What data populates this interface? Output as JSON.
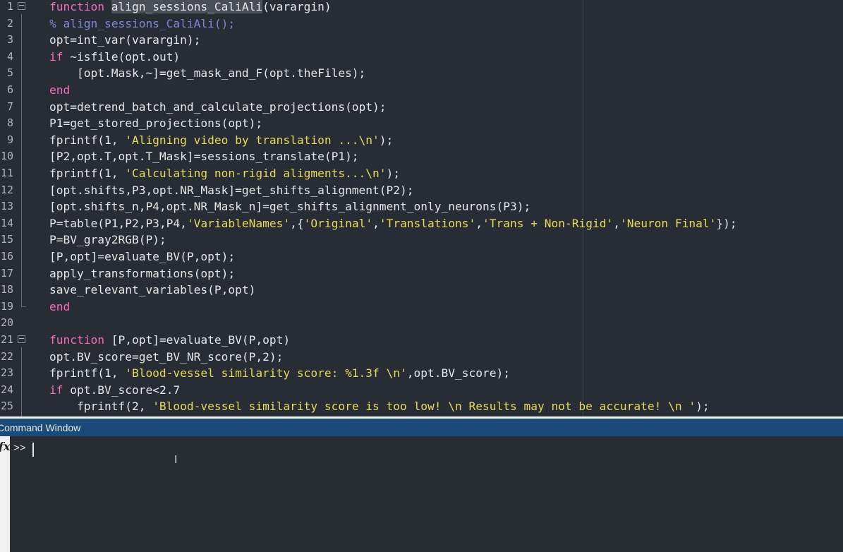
{
  "editor": {
    "lines": [
      {
        "num": "1",
        "parts": [
          {
            "t": "kw",
            "v": "function "
          },
          {
            "t": "hl",
            "v": "align_sessions_CaliAli"
          },
          {
            "t": "p",
            "v": "(varargin)"
          }
        ]
      },
      {
        "num": "2",
        "parts": [
          {
            "t": "cmt",
            "v": "% align_sessions_CaliAli();"
          }
        ]
      },
      {
        "num": "3",
        "parts": [
          {
            "t": "p",
            "v": "opt=int_var(varargin);"
          }
        ]
      },
      {
        "num": "4",
        "parts": [
          {
            "t": "kw",
            "v": "if "
          },
          {
            "t": "p",
            "v": "~isfile(opt.out)"
          }
        ]
      },
      {
        "num": "5",
        "parts": [
          {
            "t": "p",
            "v": "    [opt.Mask,~]=get_mask_and_F(opt.theFiles);"
          }
        ]
      },
      {
        "num": "6",
        "parts": [
          {
            "t": "kw",
            "v": "end"
          }
        ]
      },
      {
        "num": "7",
        "parts": [
          {
            "t": "p",
            "v": "opt=detrend_batch_and_calculate_projections(opt);"
          }
        ]
      },
      {
        "num": "8",
        "parts": [
          {
            "t": "p",
            "v": "P1=get_stored_projections(opt);"
          }
        ]
      },
      {
        "num": "9",
        "parts": [
          {
            "t": "p",
            "v": "fprintf(1, "
          },
          {
            "t": "str",
            "v": "'Aligning video by translation ...\\n'"
          },
          {
            "t": "p",
            "v": ");"
          }
        ]
      },
      {
        "num": "10",
        "parts": [
          {
            "t": "p",
            "v": "[P2,opt.T,opt.T_Mask]=sessions_translate(P1);"
          }
        ]
      },
      {
        "num": "11",
        "parts": [
          {
            "t": "p",
            "v": "fprintf(1, "
          },
          {
            "t": "str",
            "v": "'Calculating non-rigid aligments...\\n'"
          },
          {
            "t": "p",
            "v": ");"
          }
        ]
      },
      {
        "num": "12",
        "parts": [
          {
            "t": "p",
            "v": "[opt.shifts,P3,opt.NR_Mask]=get_shifts_alignment(P2);"
          }
        ]
      },
      {
        "num": "13",
        "parts": [
          {
            "t": "p",
            "v": "[opt.shifts_n,P4,opt.NR_Mask_n]=get_shifts_alignment_only_neurons(P3);"
          }
        ]
      },
      {
        "num": "14",
        "parts": [
          {
            "t": "p",
            "v": "P=table(P1,P2,P3,P4,"
          },
          {
            "t": "str",
            "v": "'VariableNames'"
          },
          {
            "t": "p",
            "v": ",{"
          },
          {
            "t": "str",
            "v": "'Original'"
          },
          {
            "t": "p",
            "v": ","
          },
          {
            "t": "str",
            "v": "'Translations'"
          },
          {
            "t": "p",
            "v": ","
          },
          {
            "t": "str",
            "v": "'Trans + Non-Rigid'"
          },
          {
            "t": "p",
            "v": ","
          },
          {
            "t": "str",
            "v": "'Neuron Final'"
          },
          {
            "t": "p",
            "v": "});"
          }
        ]
      },
      {
        "num": "15",
        "parts": [
          {
            "t": "p",
            "v": "P=BV_gray2RGB(P);"
          }
        ]
      },
      {
        "num": "16",
        "parts": [
          {
            "t": "p",
            "v": "[P,opt]=evaluate_BV(P,opt);"
          }
        ]
      },
      {
        "num": "17",
        "parts": [
          {
            "t": "p",
            "v": "apply_transformations(opt);"
          }
        ]
      },
      {
        "num": "18",
        "parts": [
          {
            "t": "p",
            "v": "save_relevant_variables(P,opt)"
          }
        ]
      },
      {
        "num": "19",
        "parts": [
          {
            "t": "kw",
            "v": "end"
          }
        ]
      },
      {
        "num": "20",
        "parts": []
      },
      {
        "num": "21",
        "parts": [
          {
            "t": "kw",
            "v": "function "
          },
          {
            "t": "p",
            "v": "[P,opt]=evaluate_BV(P,opt)"
          }
        ]
      },
      {
        "num": "22",
        "parts": [
          {
            "t": "p",
            "v": "opt.BV_score=get_BV_NR_score(P,2);"
          }
        ]
      },
      {
        "num": "23",
        "parts": [
          {
            "t": "p",
            "v": "fprintf(1, "
          },
          {
            "t": "str",
            "v": "'Blood-vessel similarity score: %1.3f \\n'"
          },
          {
            "t": "p",
            "v": ",opt.BV_score);"
          }
        ]
      },
      {
        "num": "24",
        "parts": [
          {
            "t": "kw",
            "v": "if "
          },
          {
            "t": "p",
            "v": "opt.BV_score<2.7"
          }
        ]
      },
      {
        "num": "25",
        "parts": [
          {
            "t": "p",
            "v": "    fprintf(2, "
          },
          {
            "t": "str",
            "v": "'Blood-vessel similarity score is too low! \\n Results may not be accurate! \\n '"
          },
          {
            "t": "p",
            "v": ");"
          }
        ]
      }
    ]
  },
  "command_window": {
    "title": "Command Window",
    "prompt": ">>",
    "input_value": "",
    "fx_icon": "fx-icon"
  },
  "colors": {
    "keyword": "#f26cbf",
    "string": "#e6da5a",
    "comment": "#7f86d8",
    "header": "#1a4a78"
  }
}
